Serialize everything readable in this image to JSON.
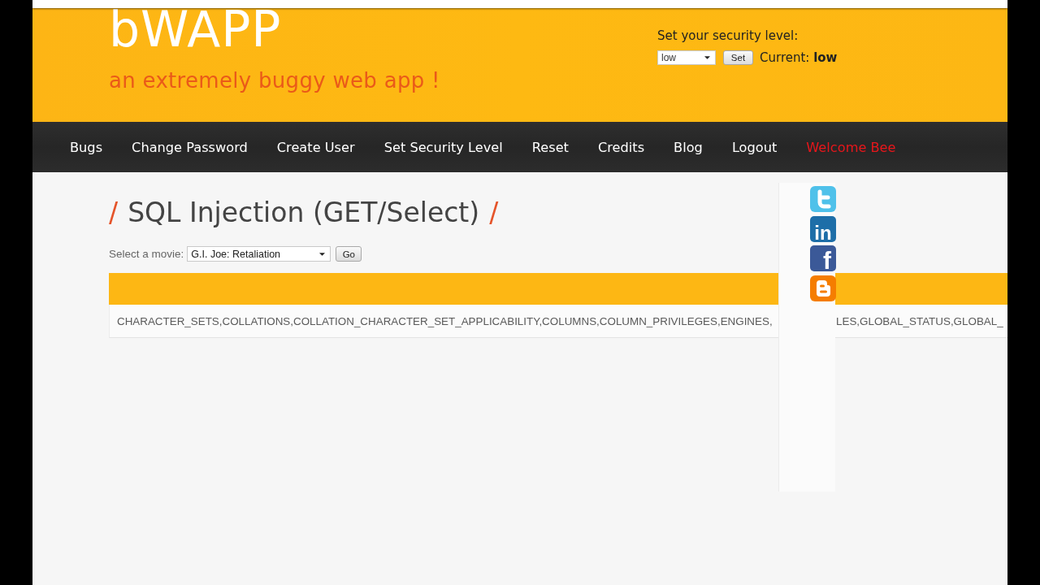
{
  "header": {
    "logo": "bWAPP",
    "tagline": "an extremely buggy web app !",
    "security": {
      "label": "Set your security level:",
      "value": "low",
      "button": "Set",
      "current": "Current: **low**"
    }
  },
  "nav": [
    {
      "label": "Bugs",
      "kind": "link"
    },
    {
      "label": "Change Password",
      "kind": "link"
    },
    {
      "label": "Create User",
      "kind": "link"
    },
    {
      "label": "Set Security Level",
      "kind": "link"
    },
    {
      "label": "Reset",
      "kind": "link"
    },
    {
      "label": "Credits",
      "kind": "link"
    },
    {
      "label": "Blog",
      "kind": "link"
    },
    {
      "label": "Logout",
      "kind": "link"
    },
    {
      "label": "Welcome Bee",
      "kind": "greeting"
    }
  ],
  "page": {
    "title": {
      "prefix": "/",
      "text": "SQL Injection (GET/Select)",
      "suffix": "/"
    },
    "form": {
      "label": "Select a movie:",
      "value": "G.I. Joe: Retaliation",
      "button": "Go"
    },
    "result": {
      "row_fragments": [
        "CHARACTER_SETS,COLLATIONS,COLLATION_CHARACTER_SET_APPLICABILITY,COLUMNS,COLUMN_PRIVILEGES,ENGINES,",
        "LES,GLOBAL_STATUS,GLOBAL_"
      ]
    }
  },
  "social_icons": [
    {
      "kind": "t-shape",
      "color": "#4fc1ea"
    },
    {
      "kind": "letters",
      "glyph": "in",
      "color": "#1e6ea8"
    },
    {
      "kind": "letters",
      "glyph": "f",
      "color": "#3b5998"
    },
    {
      "kind": "b-shape",
      "color": "#f57d00"
    }
  ]
}
